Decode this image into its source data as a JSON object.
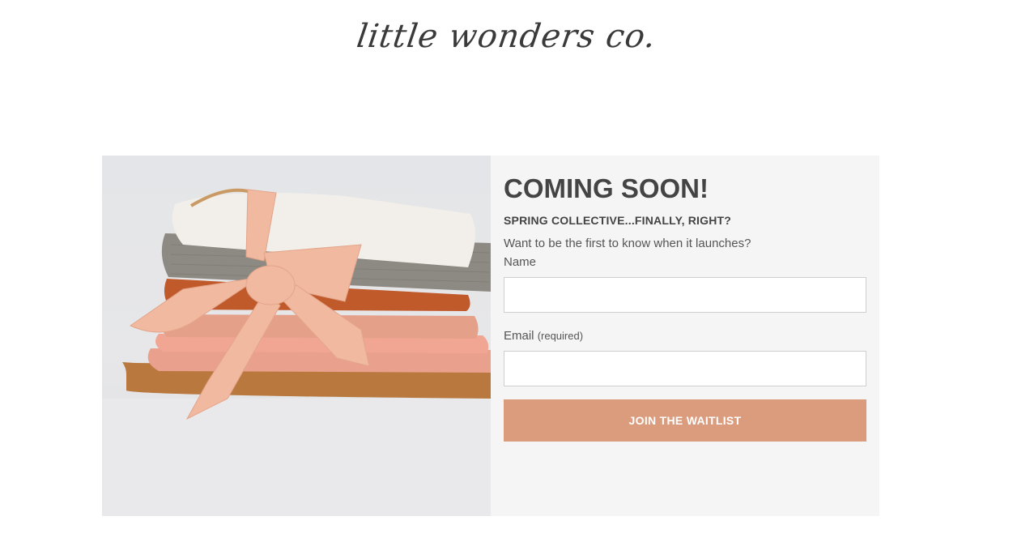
{
  "header": {
    "logo_text": "little wonders co."
  },
  "signup": {
    "heading": "COMING SOON!",
    "subheading": "SPRING COLLECTIVE...FINALLY, RIGHT?",
    "intro": "Want to be the first to know when it launches?",
    "name_label": "Name",
    "name_value": "",
    "email_label": "Email",
    "email_required": "(required)",
    "email_value": "",
    "submit_label": "JOIN THE WAITLIST"
  },
  "colors": {
    "accent": "#db9c7d",
    "panel_bg": "#f5f5f5",
    "text": "#444444"
  }
}
